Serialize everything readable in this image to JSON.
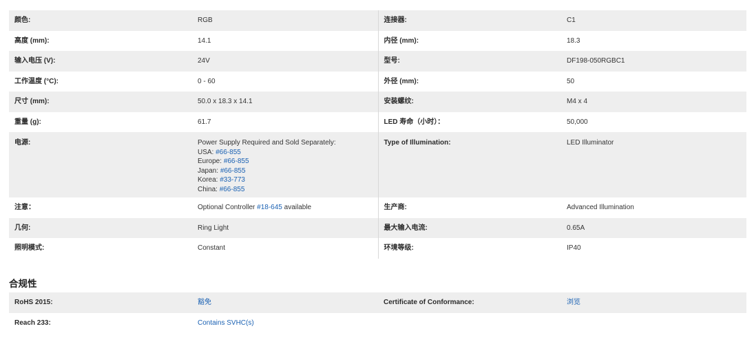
{
  "specs": {
    "rows": [
      {
        "l1": "颜色:",
        "v1": "RGB",
        "l2": "连接器:",
        "v2": "C1"
      },
      {
        "l1": "高度 (mm):",
        "v1": "14.1",
        "l2": "内径 (mm):",
        "v2": "18.3"
      },
      {
        "l1": "输入电压 (V):",
        "v1": "24V",
        "l2": "型号:",
        "v2": "DF198-050RGBC1"
      },
      {
        "l1": "工作温度 (°C):",
        "v1": "0 - 60",
        "l2": "外径 (mm):",
        "v2": "50"
      },
      {
        "l1": "尺寸 (mm):",
        "v1": "50.0 x 18.3 x 14.1",
        "l2": "安装螺纹:",
        "v2": "M4 x 4"
      },
      {
        "l1": "重量 (g):",
        "v1": "61.7",
        "l2": "LED 寿命（小时）：",
        "v2": "50,000"
      }
    ],
    "power": {
      "label": "电源:",
      "intro": "Power Supply Required and Sold Separately:",
      "usa": "USA:",
      "usa_link": "#66-855",
      "europe": "Europe:",
      "europe_link": "#66-855",
      "japan": "Japan:",
      "japan_link": "#66-855",
      "korea": "Korea:",
      "korea_link": "#33-773",
      "china": "China:",
      "china_link": "#66-855",
      "l2": "Type of Illumination:",
      "v2": "LED Illuminator"
    },
    "note": {
      "label": "注意：",
      "pre": "Optional Controller",
      "link": "#18-645",
      "post": "available",
      "l2": "生产商:",
      "v2": "Advanced Illumination"
    },
    "rows_after": [
      {
        "l1": "几何:",
        "v1": "Ring Light",
        "l2": "最大输入电流:",
        "v2": "0.65A"
      },
      {
        "l1": "照明模式:",
        "v1": "Constant",
        "l2": "环境等级:",
        "v2": "IP40"
      }
    ]
  },
  "compliance": {
    "title": "合规性",
    "rows": [
      {
        "l1": "RoHS 2015:",
        "v1": "豁免",
        "l2": "Certificate of Conformance:",
        "v2": "浏览"
      },
      {
        "l1": "Reach 233:",
        "v1": "Contains SVHC(s)",
        "l2": "",
        "v2": ""
      }
    ]
  },
  "colors": {
    "link": "#1a61b3",
    "row_shade": "#eeeeee"
  }
}
